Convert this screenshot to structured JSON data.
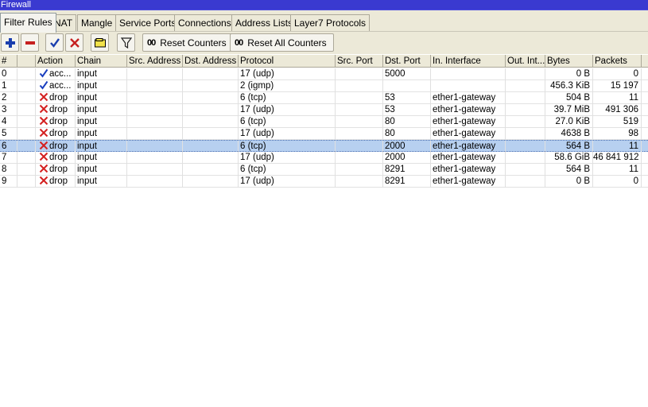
{
  "window": {
    "title": "Firewall"
  },
  "tabs": [
    {
      "label": "Filter Rules"
    },
    {
      "label": "NAT"
    },
    {
      "label": "Mangle"
    },
    {
      "label": "Service Ports"
    },
    {
      "label": "Connections"
    },
    {
      "label": "Address Lists"
    },
    {
      "label": "Layer7 Protocols"
    }
  ],
  "toolbar": {
    "add_icon": "plus-icon",
    "remove_icon": "minus-icon",
    "enable_icon": "check-icon",
    "disable_icon": "x-icon",
    "comment_icon": "note-icon",
    "filter_icon": "funnel-icon",
    "reset_counters_prefix": "00",
    "reset_counters_label": "Reset Counters",
    "reset_all_prefix": "00",
    "reset_all_label": "Reset All Counters"
  },
  "table": {
    "columns": [
      "#",
      "",
      "Action",
      "Chain",
      "Src. Address",
      "Dst. Address",
      "Protocol",
      "Src. Port",
      "Dst. Port",
      "In. Interface",
      "Out. Int...",
      "Bytes",
      "Packets"
    ],
    "rows": [
      {
        "num": "0",
        "action": "acc...",
        "action_type": "accept",
        "chain": "input",
        "src": "",
        "dst": "",
        "protocol": "17 (udp)",
        "sport": "",
        "dport": "5000",
        "in_if": "",
        "out_if": "",
        "bytes": "0 B",
        "packets": "0"
      },
      {
        "num": "1",
        "action": "acc...",
        "action_type": "accept",
        "chain": "input",
        "src": "",
        "dst": "",
        "protocol": "2 (igmp)",
        "sport": "",
        "dport": "",
        "in_if": "",
        "out_if": "",
        "bytes": "456.3 KiB",
        "packets": "15 197"
      },
      {
        "num": "2",
        "action": "drop",
        "action_type": "drop",
        "chain": "input",
        "src": "",
        "dst": "",
        "protocol": "6 (tcp)",
        "sport": "",
        "dport": "53",
        "in_if": "ether1-gateway",
        "out_if": "",
        "bytes": "504 B",
        "packets": "11"
      },
      {
        "num": "3",
        "action": "drop",
        "action_type": "drop",
        "chain": "input",
        "src": "",
        "dst": "",
        "protocol": "17 (udp)",
        "sport": "",
        "dport": "53",
        "in_if": "ether1-gateway",
        "out_if": "",
        "bytes": "39.7 MiB",
        "packets": "491 306"
      },
      {
        "num": "4",
        "action": "drop",
        "action_type": "drop",
        "chain": "input",
        "src": "",
        "dst": "",
        "protocol": "6 (tcp)",
        "sport": "",
        "dport": "80",
        "in_if": "ether1-gateway",
        "out_if": "",
        "bytes": "27.0 KiB",
        "packets": "519"
      },
      {
        "num": "5",
        "action": "drop",
        "action_type": "drop",
        "chain": "input",
        "src": "",
        "dst": "",
        "protocol": "17 (udp)",
        "sport": "",
        "dport": "80",
        "in_if": "ether1-gateway",
        "out_if": "",
        "bytes": "4638 B",
        "packets": "98"
      },
      {
        "num": "6",
        "action": "drop",
        "action_type": "drop",
        "chain": "input",
        "src": "",
        "dst": "",
        "protocol": "6 (tcp)",
        "sport": "",
        "dport": "2000",
        "in_if": "ether1-gateway",
        "out_if": "",
        "bytes": "564 B",
        "packets": "11",
        "selected": true
      },
      {
        "num": "7",
        "action": "drop",
        "action_type": "drop",
        "chain": "input",
        "src": "",
        "dst": "",
        "protocol": "17 (udp)",
        "sport": "",
        "dport": "2000",
        "in_if": "ether1-gateway",
        "out_if": "",
        "bytes": "58.6 GiB",
        "packets": "46 841 912"
      },
      {
        "num": "8",
        "action": "drop",
        "action_type": "drop",
        "chain": "input",
        "src": "",
        "dst": "",
        "protocol": "6 (tcp)",
        "sport": "",
        "dport": "8291",
        "in_if": "ether1-gateway",
        "out_if": "",
        "bytes": "564 B",
        "packets": "11"
      },
      {
        "num": "9",
        "action": "drop",
        "action_type": "drop",
        "chain": "input",
        "src": "",
        "dst": "",
        "protocol": "17 (udp)",
        "sport": "",
        "dport": "8291",
        "in_if": "ether1-gateway",
        "out_if": "",
        "bytes": "0 B",
        "packets": "0"
      }
    ]
  },
  "colors": {
    "titlebar": "#3a3ad0",
    "accept_check": "#1a3fbf",
    "drop_x": "#d42020",
    "selection": "#b7d0f0"
  }
}
